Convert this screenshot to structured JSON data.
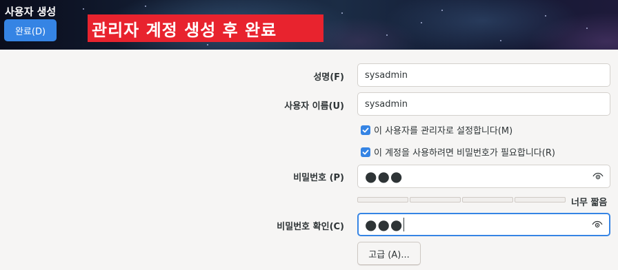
{
  "header": {
    "title": "사용자 생성",
    "done_label": "완료(D)",
    "banner_text": "관리자 계정 생성 후 완료",
    "banner_color": "#e8232e",
    "done_color": "#3584e4"
  },
  "form": {
    "fullname_label": "성명(F)",
    "fullname_value": "sysadmin",
    "username_label": "사용자 이름(U)",
    "username_value": "sysadmin",
    "admin_checkbox_label": "이 사용자를 관리자로 설정합니다(M)",
    "admin_checked": true,
    "require_pw_checkbox_label": "이 계정을 사용하려면 비밀번호가 필요합니다(R)",
    "require_pw_checked": true,
    "password_label": "비밀번호 (P)",
    "password_dots": "●●●",
    "password_strength_label": "너무 짧음",
    "password_strength_level": 0,
    "confirm_label": "비밀번호 확인(C)",
    "confirm_dots": "●●●",
    "advanced_label": "고급 (A)...",
    "eye_icon": "eye-icon",
    "accent_color": "#3584e4"
  }
}
